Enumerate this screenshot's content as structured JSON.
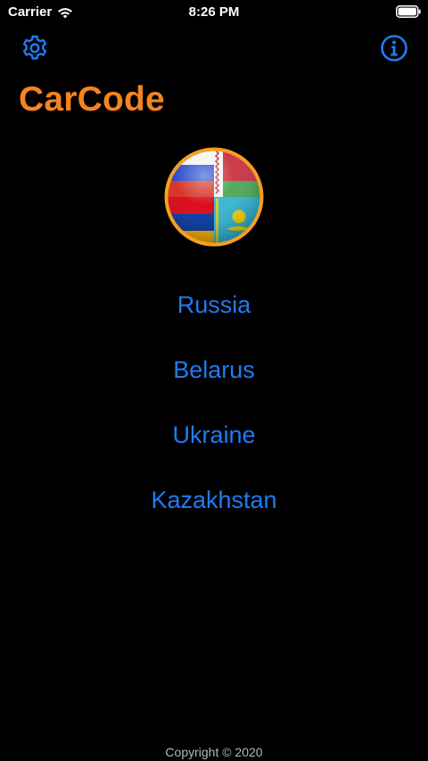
{
  "status_bar": {
    "carrier": "Carrier",
    "time": "8:26 PM",
    "wifi_icon": "wifi-icon",
    "battery_icon": "battery-icon"
  },
  "nav": {
    "settings_icon": "gear-icon",
    "info_icon": "info-icon"
  },
  "app": {
    "title": "CarCode",
    "emblem_icon": "country-flags-emblem"
  },
  "countries": [
    {
      "label": "Russia"
    },
    {
      "label": "Belarus"
    },
    {
      "label": "Ukraine"
    },
    {
      "label": "Kazakhstan"
    }
  ],
  "footer": {
    "copyright": "Copyright © 2020"
  },
  "colors": {
    "background": "#000000",
    "accent_orange": "#f5831f",
    "link_blue": "#1e7cf2"
  }
}
